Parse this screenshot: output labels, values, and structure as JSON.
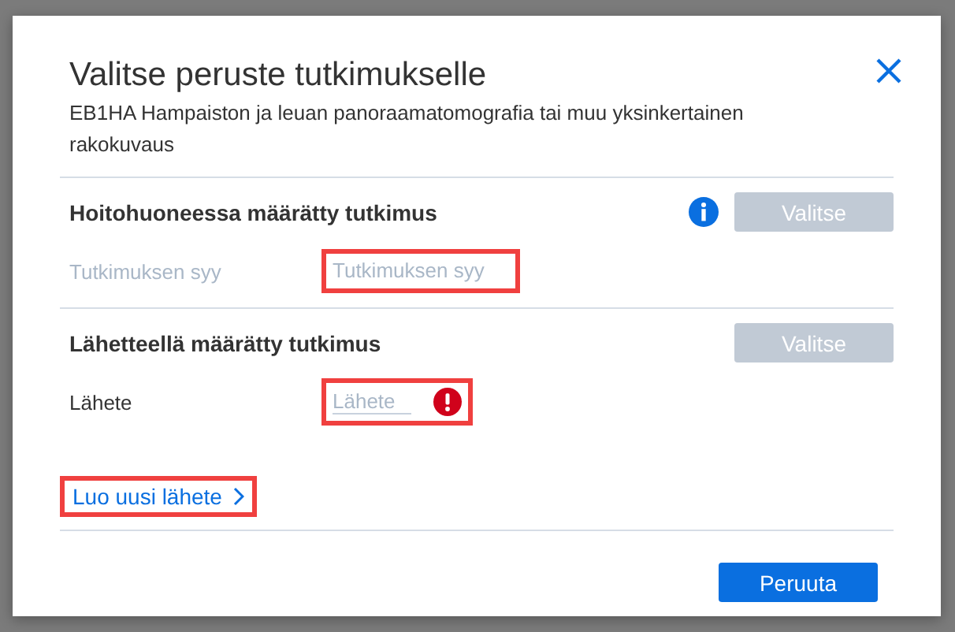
{
  "dialog": {
    "title": "Valitse peruste tutkimukselle",
    "subtitle": "EB1HA Hampaiston ja leuan panoraamatomografia tai muu yksinkertainen rakokuvaus"
  },
  "sections": [
    {
      "heading": "Hoitohuoneessa määrätty tutkimus",
      "info": true,
      "button": {
        "label": "Valitse",
        "disabled": true
      },
      "field": {
        "label": "Tutkimuksen syy",
        "placeholder": "Tutkimuksen syy",
        "disabled": true,
        "error": false,
        "highlighted": true
      }
    },
    {
      "heading": "Lähetteellä määrätty tutkimus",
      "info": false,
      "button": {
        "label": "Valitse",
        "disabled": true
      },
      "field": {
        "label": "Lähete",
        "placeholder": "Lähete",
        "disabled": false,
        "error": true,
        "highlighted": true
      }
    }
  ],
  "link": {
    "label": "Luo uusi lähete",
    "highlighted": true
  },
  "footer_button": {
    "label": "Peruuta"
  }
}
